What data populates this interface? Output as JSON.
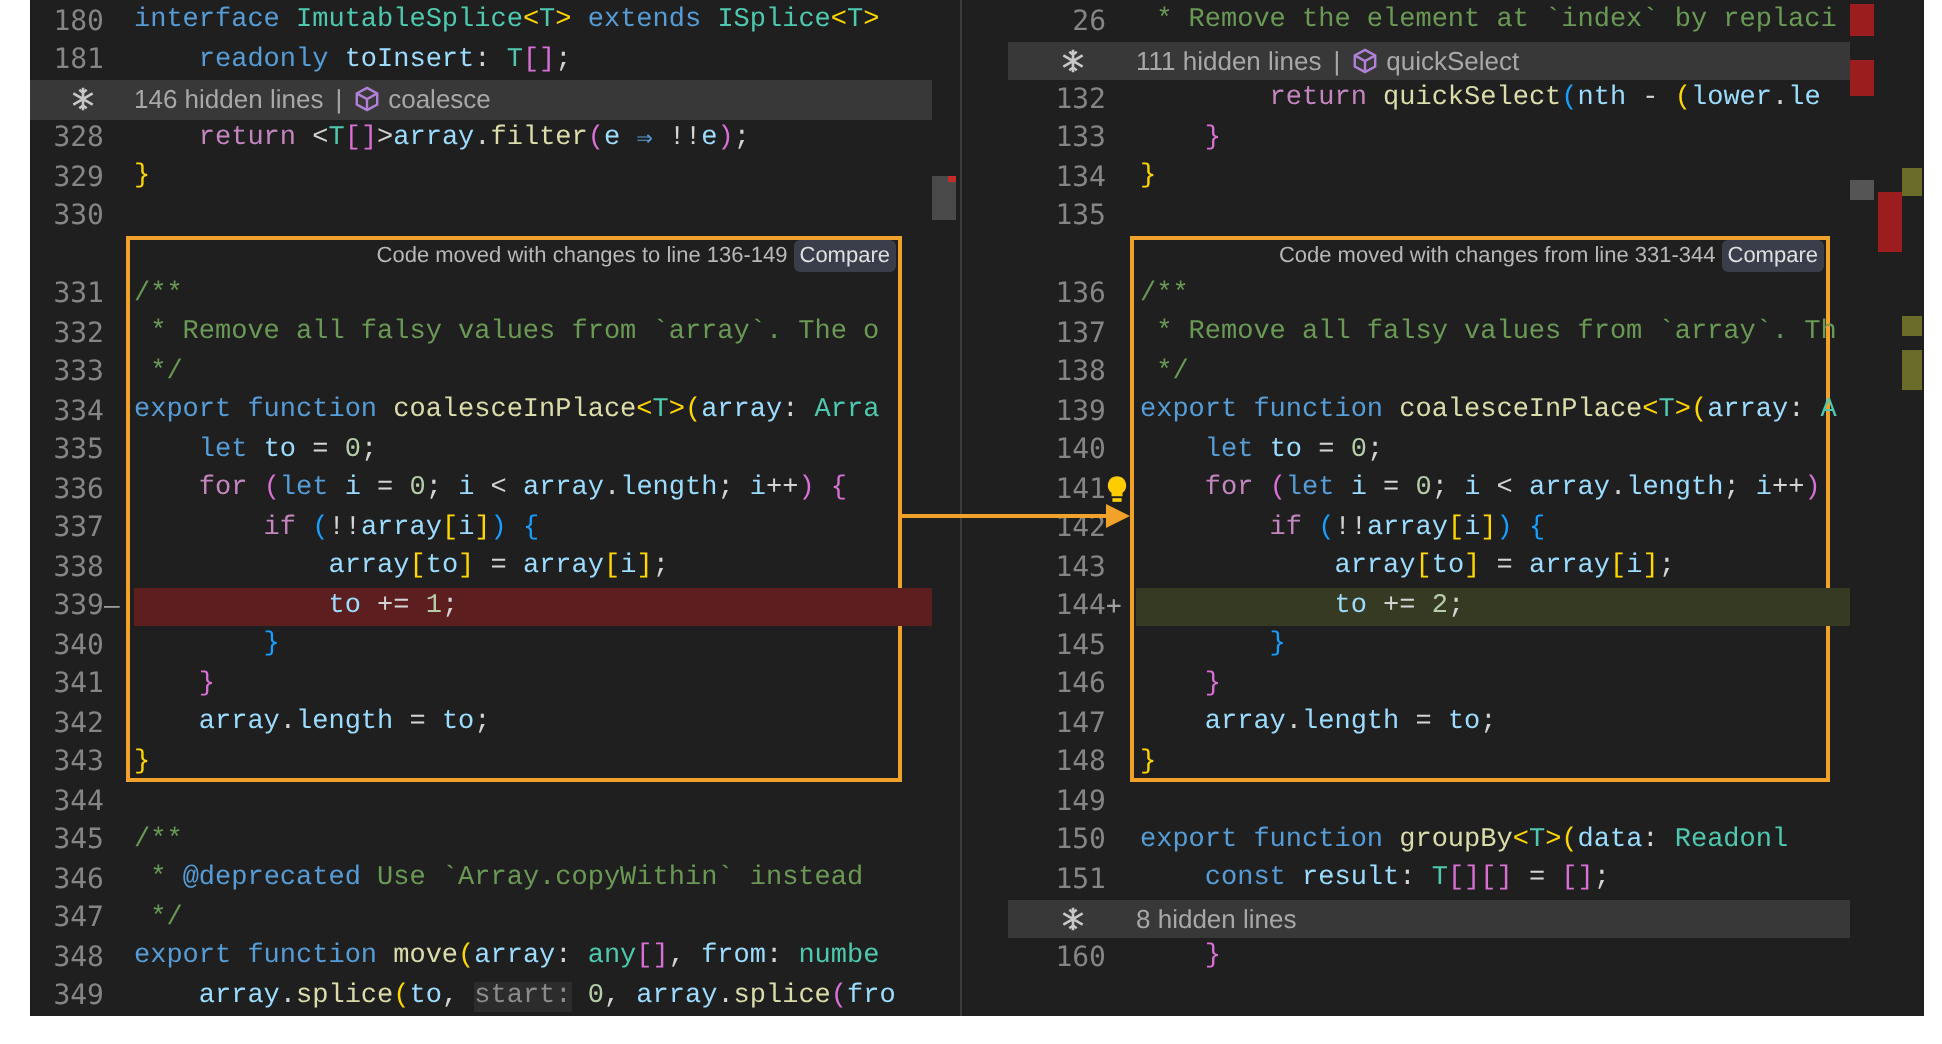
{
  "panes": [
    {
      "rows": [
        {
          "kind": "code",
          "number": "180",
          "tokens": [
            {
              "kind": "keyword",
              "text": "interface "
            },
            {
              "kind": "type",
              "text": "ImutableSplice"
            },
            {
              "kind": "bracket",
              "text": "<"
            },
            {
              "kind": "type",
              "text": "T"
            },
            {
              "kind": "bracket",
              "text": ">"
            },
            {
              "kind": "keyword",
              "text": " extends "
            },
            {
              "kind": "type",
              "text": "ISplice"
            },
            {
              "kind": "bracket",
              "text": "<"
            },
            {
              "kind": "type",
              "text": "T"
            },
            {
              "kind": "bracket",
              "text": ">"
            }
          ]
        },
        {
          "kind": "code",
          "number": "181",
          "tokens": [
            {
              "kind": "keyword",
              "text": "    readonly "
            },
            {
              "kind": "variable",
              "text": "toInsert"
            },
            {
              "kind": "plain",
              "text": ": "
            },
            {
              "kind": "type",
              "text": "T"
            },
            {
              "kind": "bracket2",
              "text": "[]"
            },
            {
              "kind": "plain",
              "text": ";"
            }
          ]
        },
        {
          "kind": "folded",
          "text": "146 hidden lines",
          "separator": "|",
          "symbol": "coalesce"
        },
        {
          "kind": "code",
          "number": "328",
          "tokens": [
            {
              "kind": "control",
              "text": "    return "
            },
            {
              "kind": "plain",
              "text": "<"
            },
            {
              "kind": "type",
              "text": "T"
            },
            {
              "kind": "bracket2",
              "text": "[]"
            },
            {
              "kind": "plain",
              "text": ">"
            },
            {
              "kind": "variable",
              "text": "array"
            },
            {
              "kind": "plain",
              "text": "."
            },
            {
              "kind": "function",
              "text": "filter"
            },
            {
              "kind": "bracket2",
              "text": "("
            },
            {
              "kind": "variable",
              "text": "e"
            },
            {
              "kind": "keyword",
              "text": " ⇒ "
            },
            {
              "kind": "plain",
              "text": "!!"
            },
            {
              "kind": "variable",
              "text": "e"
            },
            {
              "kind": "bracket2",
              "text": ")"
            },
            {
              "kind": "plain",
              "text": ";"
            }
          ]
        },
        {
          "kind": "code",
          "number": "329",
          "tokens": [
            {
              "kind": "bracket",
              "text": "}"
            }
          ]
        },
        {
          "kind": "code",
          "number": "330"
        },
        {
          "kind": "moved",
          "label": "Code moved with changes to line 136-149",
          "button": "Compare",
          "lines": [
            {
              "kind": "context",
              "number": "331",
              "tokens": [
                {
                  "kind": "comment",
                  "text": "/**"
                }
              ]
            },
            {
              "kind": "context",
              "number": "332",
              "tokens": [
                {
                  "kind": "comment",
                  "text": " * Remove all falsy values from `array`. The o"
                }
              ]
            },
            {
              "kind": "context",
              "number": "333",
              "tokens": [
                {
                  "kind": "comment",
                  "text": " */"
                }
              ]
            },
            {
              "kind": "context",
              "number": "334",
              "tokens": [
                {
                  "kind": "keyword",
                  "text": "export function "
                },
                {
                  "kind": "function",
                  "text": "coalesceInPlace"
                },
                {
                  "kind": "bracket",
                  "text": "<"
                },
                {
                  "kind": "type",
                  "text": "T"
                },
                {
                  "kind": "bracket",
                  "text": ">("
                },
                {
                  "kind": "variable",
                  "text": "array"
                },
                {
                  "kind": "plain",
                  "text": ": "
                },
                {
                  "kind": "type",
                  "text": "Arra"
                }
              ]
            },
            {
              "kind": "context",
              "number": "335",
              "tokens": [
                {
                  "kind": "keyword",
                  "text": "    let "
                },
                {
                  "kind": "variable",
                  "text": "to"
                },
                {
                  "kind": "plain",
                  "text": " = "
                },
                {
                  "kind": "number",
                  "text": "0"
                },
                {
                  "kind": "plain",
                  "text": ";"
                }
              ]
            },
            {
              "kind": "context",
              "number": "336",
              "tokens": [
                {
                  "kind": "control",
                  "text": "    for "
                },
                {
                  "kind": "bracket2",
                  "text": "("
                },
                {
                  "kind": "keyword",
                  "text": "let "
                },
                {
                  "kind": "variable",
                  "text": "i"
                },
                {
                  "kind": "plain",
                  "text": " = "
                },
                {
                  "kind": "number",
                  "text": "0"
                },
                {
                  "kind": "plain",
                  "text": "; "
                },
                {
                  "kind": "variable",
                  "text": "i"
                },
                {
                  "kind": "plain",
                  "text": " < "
                },
                {
                  "kind": "variable",
                  "text": "array"
                },
                {
                  "kind": "plain",
                  "text": "."
                },
                {
                  "kind": "variable",
                  "text": "length"
                },
                {
                  "kind": "plain",
                  "text": "; "
                },
                {
                  "kind": "variable",
                  "text": "i"
                },
                {
                  "kind": "plain",
                  "text": "++"
                },
                {
                  "kind": "bracket2",
                  "text": ") {"
                }
              ]
            },
            {
              "kind": "context",
              "number": "337",
              "tokens": [
                {
                  "kind": "control",
                  "text": "        if "
                },
                {
                  "kind": "bracket3",
                  "text": "("
                },
                {
                  "kind": "plain",
                  "text": "!!"
                },
                {
                  "kind": "variable",
                  "text": "array"
                },
                {
                  "kind": "bracket",
                  "text": "["
                },
                {
                  "kind": "variable",
                  "text": "i"
                },
                {
                  "kind": "bracket",
                  "text": "]"
                },
                {
                  "kind": "bracket3",
                  "text": ") {"
                }
              ]
            },
            {
              "kind": "context",
              "number": "338",
              "tokens": [
                {
                  "kind": "variable",
                  "text": "            array"
                },
                {
                  "kind": "bracket",
                  "text": "["
                },
                {
                  "kind": "variable",
                  "text": "to"
                },
                {
                  "kind": "bracket",
                  "text": "]"
                },
                {
                  "kind": "plain",
                  "text": " = "
                },
                {
                  "kind": "variable",
                  "text": "array"
                },
                {
                  "kind": "bracket",
                  "text": "["
                },
                {
                  "kind": "variable",
                  "text": "i"
                },
                {
                  "kind": "bracket",
                  "text": "]"
                },
                {
                  "kind": "plain",
                  "text": ";"
                }
              ]
            },
            {
              "kind": "removed",
              "number": "339",
              "gutter_sign": "—",
              "tokens": [
                {
                  "kind": "variable",
                  "text": "            to"
                },
                {
                  "kind": "plain",
                  "text": " += "
                },
                {
                  "kind": "number",
                  "text": "1"
                },
                {
                  "kind": "plain",
                  "text": ";"
                }
              ]
            },
            {
              "kind": "context",
              "number": "340",
              "tokens": [
                {
                  "kind": "bracket3",
                  "text": "        }"
                }
              ]
            },
            {
              "kind": "context",
              "number": "341",
              "tokens": [
                {
                  "kind": "bracket2",
                  "text": "    }"
                }
              ]
            },
            {
              "kind": "context",
              "number": "342",
              "tokens": [
                {
                  "kind": "variable",
                  "text": "    array"
                },
                {
                  "kind": "plain",
                  "text": "."
                },
                {
                  "kind": "variable",
                  "text": "length"
                },
                {
                  "kind": "plain",
                  "text": " = "
                },
                {
                  "kind": "variable",
                  "text": "to"
                },
                {
                  "kind": "plain",
                  "text": ";"
                }
              ]
            },
            {
              "kind": "context",
              "number": "343",
              "tokens": [
                {
                  "kind": "bracket",
                  "text": "}"
                }
              ]
            }
          ]
        },
        {
          "kind": "code",
          "number": "344"
        },
        {
          "kind": "code",
          "number": "345",
          "tokens": [
            {
              "kind": "comment",
              "text": "/**"
            }
          ]
        },
        {
          "kind": "code",
          "number": "346",
          "tokens": [
            {
              "kind": "comment",
              "text": " * "
            },
            {
              "kind": "keyword",
              "text": "@deprecated"
            },
            {
              "kind": "comment",
              "text": " Use `Array.copyWithin` instead"
            }
          ]
        },
        {
          "kind": "code",
          "number": "347",
          "tokens": [
            {
              "kind": "comment",
              "text": " */"
            }
          ]
        },
        {
          "kind": "code",
          "number": "348",
          "tokens": [
            {
              "kind": "keyword",
              "text": "export function "
            },
            {
              "kind": "function",
              "text": "move"
            },
            {
              "kind": "bracket",
              "text": "("
            },
            {
              "kind": "variable",
              "text": "array"
            },
            {
              "kind": "plain",
              "text": ": "
            },
            {
              "kind": "type",
              "text": "any"
            },
            {
              "kind": "bracket2",
              "text": "[]"
            },
            {
              "kind": "plain",
              "text": ", "
            },
            {
              "kind": "variable",
              "text": "from"
            },
            {
              "kind": "plain",
              "text": ": "
            },
            {
              "kind": "type",
              "text": "numbe"
            }
          ]
        },
        {
          "kind": "code",
          "number": "349",
          "tokens": [
            {
              "kind": "variable",
              "text": "    array"
            },
            {
              "kind": "plain",
              "text": "."
            },
            {
              "kind": "function",
              "text": "splice"
            },
            {
              "kind": "bracket",
              "text": "("
            },
            {
              "kind": "variable",
              "text": "to"
            },
            {
              "kind": "plain",
              "text": ", "
            },
            {
              "kind": "hint",
              "text": "start:"
            },
            {
              "kind": "number",
              "text": " 0"
            },
            {
              "kind": "plain",
              "text": ", "
            },
            {
              "kind": "variable",
              "text": "array"
            },
            {
              "kind": "plain",
              "text": "."
            },
            {
              "kind": "function",
              "text": "splice"
            },
            {
              "kind": "bracket2",
              "text": "("
            },
            {
              "kind": "variable",
              "text": "fro"
            }
          ]
        }
      ]
    },
    {
      "rows": [
        {
          "kind": "code",
          "number": "26",
          "tokens": [
            {
              "kind": "comment",
              "text": " * Remove the element at `index` by replaci"
            }
          ]
        },
        {
          "kind": "folded",
          "text": "111 hidden lines",
          "separator": "|",
          "symbol": "quickSelect"
        },
        {
          "kind": "code",
          "number": "132",
          "tokens": [
            {
              "kind": "control",
              "text": "        return "
            },
            {
              "kind": "function",
              "text": "quickSelect"
            },
            {
              "kind": "bracket3",
              "text": "("
            },
            {
              "kind": "variable",
              "text": "nth"
            },
            {
              "kind": "plain",
              "text": " - "
            },
            {
              "kind": "bracket",
              "text": "("
            },
            {
              "kind": "variable",
              "text": "lower"
            },
            {
              "kind": "plain",
              "text": "."
            },
            {
              "kind": "variable",
              "text": "le"
            }
          ]
        },
        {
          "kind": "code",
          "number": "133",
          "tokens": [
            {
              "kind": "bracket2",
              "text": "    }"
            }
          ]
        },
        {
          "kind": "code",
          "number": "134",
          "tokens": [
            {
              "kind": "bracket",
              "text": "}"
            }
          ]
        },
        {
          "kind": "code",
          "number": "135"
        },
        {
          "kind": "moved",
          "label": "Code moved with changes from line 331-344",
          "button": "Compare",
          "lines": [
            {
              "kind": "context",
              "lightbulb": false,
              "number": "136",
              "tokens": [
                {
                  "kind": "comment",
                  "text": "/**"
                }
              ]
            },
            {
              "kind": "context",
              "lightbulb": false,
              "number": "137",
              "tokens": [
                {
                  "kind": "comment",
                  "text": " * Remove all falsy values from `array`. Th"
                }
              ]
            },
            {
              "kind": "context",
              "lightbulb": false,
              "number": "138",
              "tokens": [
                {
                  "kind": "comment",
                  "text": " */"
                }
              ]
            },
            {
              "kind": "context",
              "lightbulb": false,
              "number": "139",
              "tokens": [
                {
                  "kind": "keyword",
                  "text": "export function "
                },
                {
                  "kind": "function",
                  "text": "coalesceInPlace"
                },
                {
                  "kind": "bracket",
                  "text": "<"
                },
                {
                  "kind": "type",
                  "text": "T"
                },
                {
                  "kind": "bracket",
                  "text": ">("
                },
                {
                  "kind": "variable",
                  "text": "array"
                },
                {
                  "kind": "plain",
                  "text": ": "
                },
                {
                  "kind": "type",
                  "text": "A"
                }
              ]
            },
            {
              "kind": "context",
              "lightbulb": false,
              "number": "140",
              "tokens": [
                {
                  "kind": "keyword",
                  "text": "    let "
                },
                {
                  "kind": "variable",
                  "text": "to"
                },
                {
                  "kind": "plain",
                  "text": " = "
                },
                {
                  "kind": "number",
                  "text": "0"
                },
                {
                  "kind": "plain",
                  "text": ";"
                }
              ]
            },
            {
              "kind": "context",
              "lightbulb": true,
              "number": "141",
              "tokens": [
                {
                  "kind": "control",
                  "text": "    for "
                },
                {
                  "kind": "bracket2",
                  "text": "("
                },
                {
                  "kind": "keyword",
                  "text": "let "
                },
                {
                  "kind": "variable",
                  "text": "i"
                },
                {
                  "kind": "plain",
                  "text": " = "
                },
                {
                  "kind": "number",
                  "text": "0"
                },
                {
                  "kind": "plain",
                  "text": "; "
                },
                {
                  "kind": "variable",
                  "text": "i"
                },
                {
                  "kind": "plain",
                  "text": " < "
                },
                {
                  "kind": "variable",
                  "text": "array"
                },
                {
                  "kind": "plain",
                  "text": "."
                },
                {
                  "kind": "variable",
                  "text": "length"
                },
                {
                  "kind": "plain",
                  "text": "; "
                },
                {
                  "kind": "variable",
                  "text": "i"
                },
                {
                  "kind": "plain",
                  "text": "++"
                },
                {
                  "kind": "bracket2",
                  "text": ")"
                }
              ]
            },
            {
              "kind": "context",
              "lightbulb": false,
              "number": "142",
              "tokens": [
                {
                  "kind": "control",
                  "text": "        if "
                },
                {
                  "kind": "bracket3",
                  "text": "("
                },
                {
                  "kind": "plain",
                  "text": "!!"
                },
                {
                  "kind": "variable",
                  "text": "array"
                },
                {
                  "kind": "bracket",
                  "text": "["
                },
                {
                  "kind": "variable",
                  "text": "i"
                },
                {
                  "kind": "bracket",
                  "text": "]"
                },
                {
                  "kind": "bracket3",
                  "text": ") {"
                }
              ]
            },
            {
              "kind": "context",
              "lightbulb": false,
              "number": "143",
              "tokens": [
                {
                  "kind": "variable",
                  "text": "            array"
                },
                {
                  "kind": "bracket",
                  "text": "["
                },
                {
                  "kind": "variable",
                  "text": "to"
                },
                {
                  "kind": "bracket",
                  "text": "]"
                },
                {
                  "kind": "plain",
                  "text": " = "
                },
                {
                  "kind": "variable",
                  "text": "array"
                },
                {
                  "kind": "bracket",
                  "text": "["
                },
                {
                  "kind": "variable",
                  "text": "i"
                },
                {
                  "kind": "bracket",
                  "text": "]"
                },
                {
                  "kind": "plain",
                  "text": ";"
                }
              ]
            },
            {
              "kind": "added",
              "lightbulb": false,
              "number": "144",
              "gutter_sign": "+",
              "tokens": [
                {
                  "kind": "variable",
                  "text": "            to"
                },
                {
                  "kind": "plain",
                  "text": " += "
                },
                {
                  "kind": "number",
                  "text": "2"
                },
                {
                  "kind": "plain",
                  "text": ";"
                }
              ]
            },
            {
              "kind": "context",
              "lightbulb": false,
              "number": "145",
              "tokens": [
                {
                  "kind": "bracket3",
                  "text": "        }"
                }
              ]
            },
            {
              "kind": "context",
              "lightbulb": false,
              "number": "146",
              "tokens": [
                {
                  "kind": "bracket2",
                  "text": "    }"
                }
              ]
            },
            {
              "kind": "context",
              "lightbulb": false,
              "number": "147",
              "tokens": [
                {
                  "kind": "variable",
                  "text": "    array"
                },
                {
                  "kind": "plain",
                  "text": "."
                },
                {
                  "kind": "variable",
                  "text": "length"
                },
                {
                  "kind": "plain",
                  "text": " = "
                },
                {
                  "kind": "variable",
                  "text": "to"
                },
                {
                  "kind": "plain",
                  "text": ";"
                }
              ]
            },
            {
              "kind": "context",
              "lightbulb": false,
              "number": "148",
              "tokens": [
                {
                  "kind": "bracket",
                  "text": "}"
                }
              ]
            }
          ]
        },
        {
          "kind": "code",
          "number": "149"
        },
        {
          "kind": "code",
          "number": "150",
          "tokens": [
            {
              "kind": "keyword",
              "text": "export function "
            },
            {
              "kind": "function",
              "text": "groupBy"
            },
            {
              "kind": "bracket",
              "text": "<"
            },
            {
              "kind": "type",
              "text": "T"
            },
            {
              "kind": "bracket",
              "text": ">("
            },
            {
              "kind": "variable",
              "text": "data"
            },
            {
              "kind": "plain",
              "text": ": "
            },
            {
              "kind": "type",
              "text": "Readonl"
            }
          ]
        },
        {
          "kind": "code",
          "number": "151",
          "tokens": [
            {
              "kind": "keyword",
              "text": "    const "
            },
            {
              "kind": "variable",
              "text": "result"
            },
            {
              "kind": "plain",
              "text": ": "
            },
            {
              "kind": "type",
              "text": "T"
            },
            {
              "kind": "bracket2",
              "text": "[][]"
            },
            {
              "kind": "plain",
              "text": " = "
            },
            {
              "kind": "bracket2",
              "text": "[]"
            },
            {
              "kind": "plain",
              "text": ";"
            }
          ]
        },
        {
          "kind": "folded",
          "text": "8 hidden lines"
        },
        {
          "kind": "code",
          "number": "160",
          "tokens": [
            {
              "kind": "bracket2",
              "text": "    }"
            }
          ]
        }
      ]
    }
  ]
}
